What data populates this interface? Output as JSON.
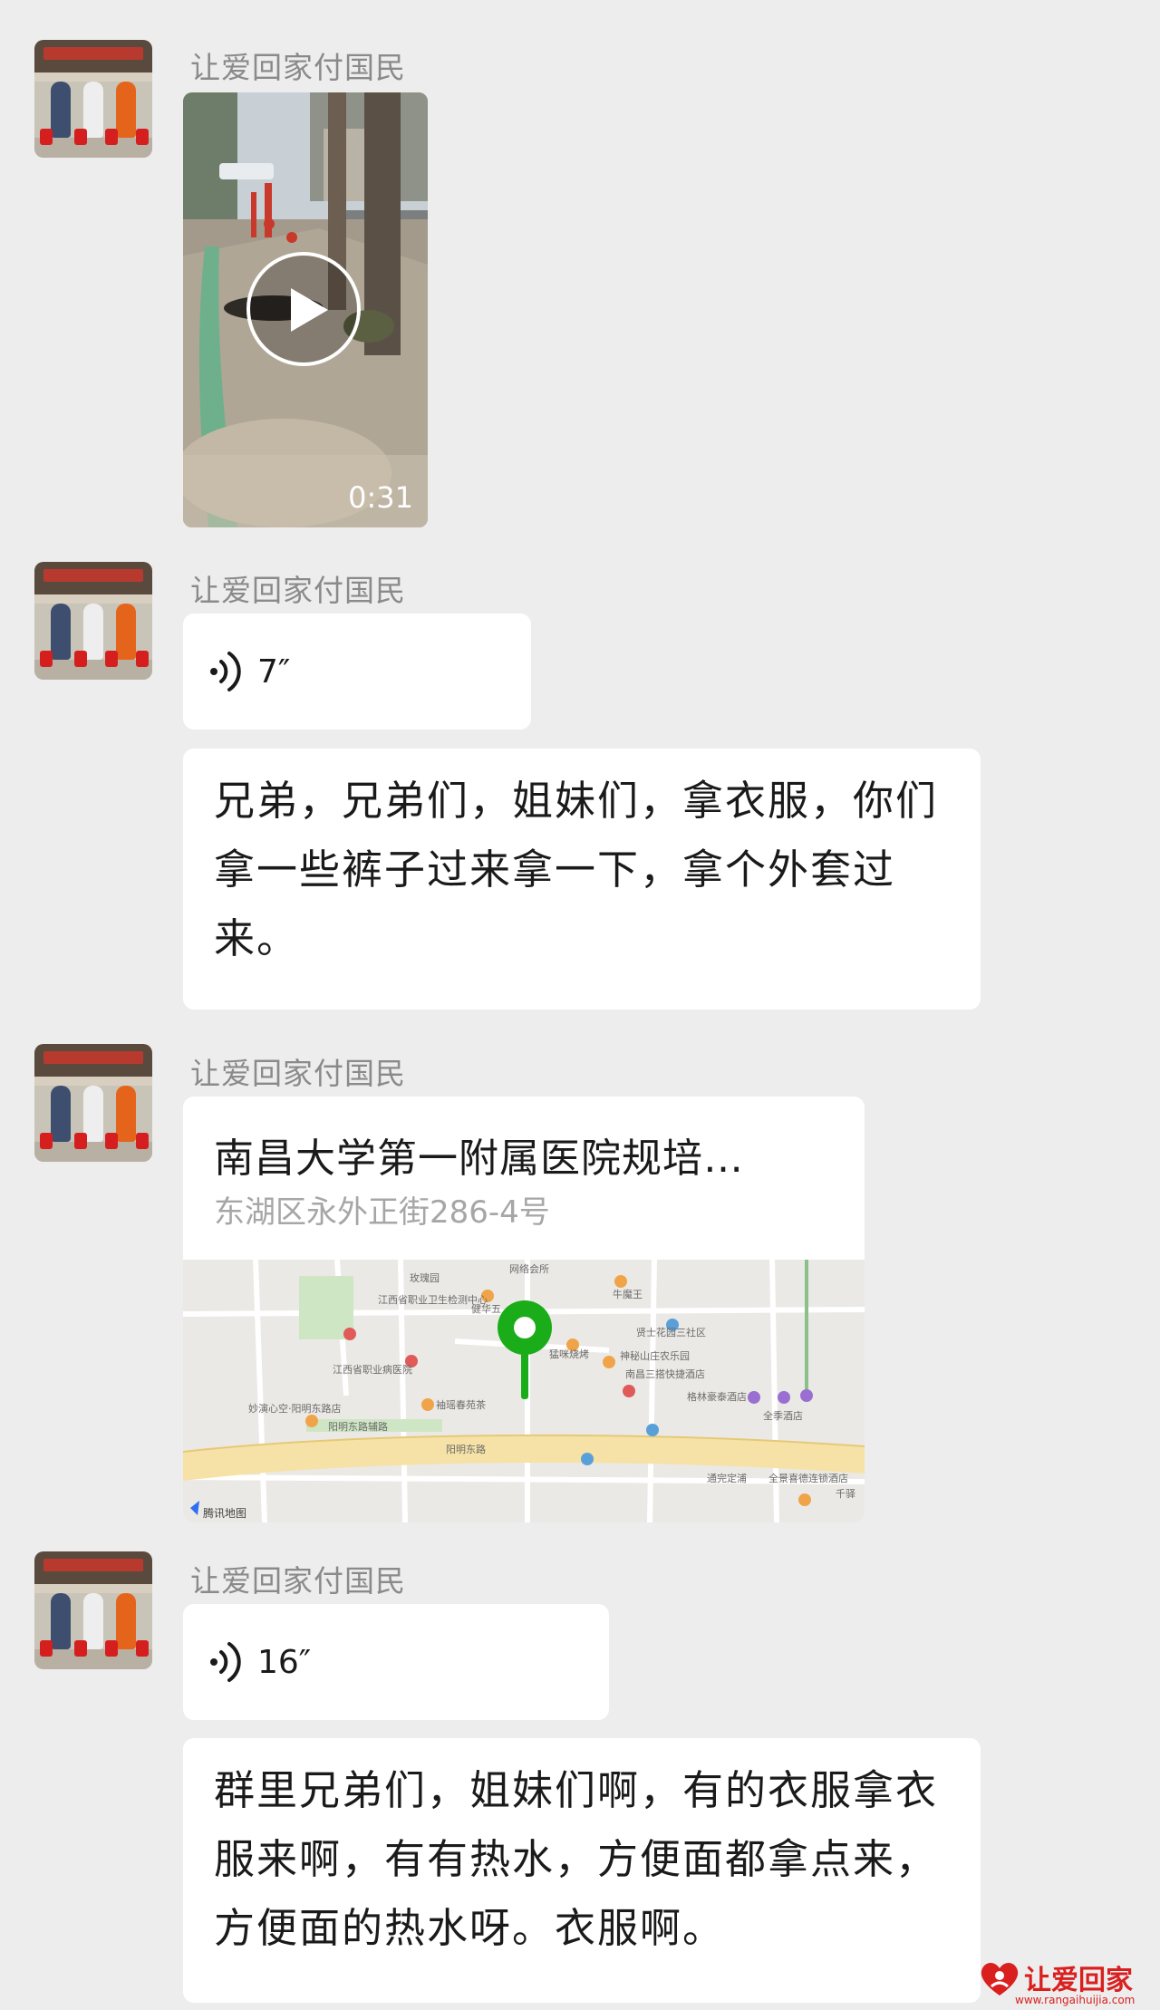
{
  "messages": [
    {
      "sender": "让爱回家付国民",
      "type": "video",
      "duration": "0:31"
    },
    {
      "sender": "让爱回家付国民",
      "type": "voice",
      "duration": "7″",
      "transcript": "兄弟，兄弟们，姐妹们，拿衣服，你们拿一些裤子过来拿一下，拿个外套过来。"
    },
    {
      "sender": "让爱回家付国民",
      "type": "location",
      "title": "南昌大学第一附属医院规培…",
      "address": "东湖区永外正街286-4号",
      "map": {
        "labels": [
          "网络会所",
          "玫瑰园",
          "江西省职业卫生检测中心",
          "健华五",
          "牛魔王",
          "贤士花园三社区",
          "猛咪烧烤",
          "神秘山庄农乐园",
          "江西省职业病医院",
          "南昌三搭快捷酒店",
          "格林豪泰酒店",
          "全季酒店",
          "妙演心空·阳明东路店",
          "阳明东路辅路",
          "阳明东路",
          "袖瑶春苑茶",
          "通完定浦",
          "全景喜德连锁酒店",
          "千驿",
          "腾讯地图"
        ]
      }
    },
    {
      "sender": "让爱回家付国民",
      "type": "voice",
      "duration": "16″",
      "transcript": "群里兄弟们，姐妹们啊，有的衣服拿衣服来啊，有有热水，方便面都拿点来，方便面的热水呀。衣服啊。"
    }
  ],
  "watermark": {
    "text": "让爱回家",
    "url": "www.rangaihuijia.com"
  },
  "colors": {
    "background": "#ededed",
    "bubble": "#ffffff",
    "pin": "#1aad19",
    "sender": "#8a8a8a",
    "watermark": "#d9201f"
  }
}
